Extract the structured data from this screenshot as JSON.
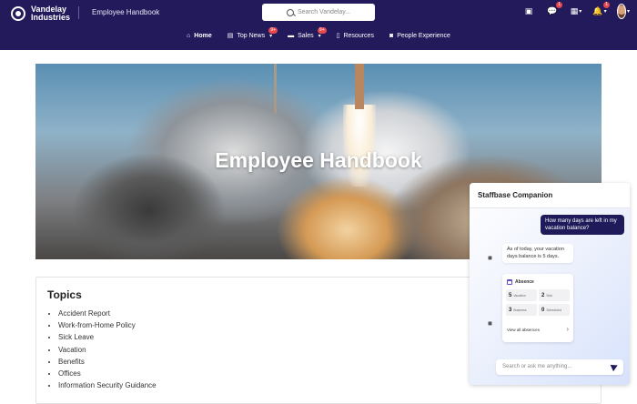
{
  "brand": {
    "name": "Vandelay Industries",
    "logo_icon": "vandelay-logo-icon"
  },
  "site_title": "Employee Handbook",
  "search": {
    "placeholder": "Search Vandelay..."
  },
  "header_icons": {
    "contacts": {
      "icon": "contact-card-icon"
    },
    "chat": {
      "icon": "chat-icon",
      "badge": "1"
    },
    "apps": {
      "icon": "grid-icon"
    },
    "notifications": {
      "icon": "bell-icon",
      "badge": "1"
    },
    "profile": {
      "icon": "avatar"
    }
  },
  "nav": [
    {
      "label": "Home",
      "icon": "home-icon",
      "active": true
    },
    {
      "label": "Top News",
      "icon": "news-icon",
      "badge": "9+",
      "has_dropdown": true
    },
    {
      "label": "Sales",
      "icon": "folder-icon",
      "badge": "9+",
      "has_dropdown": true
    },
    {
      "label": "Resources",
      "icon": "document-icon"
    },
    {
      "label": "People Experience",
      "icon": "camera-icon"
    }
  ],
  "hero": {
    "title": "Employee Handbook"
  },
  "topics": {
    "title": "Topics",
    "items": [
      "Accident Report",
      "Work-from-Home Policy",
      "Sick Leave",
      "Vacation",
      "Benefits",
      "Offices",
      "Information Security Guidance"
    ]
  },
  "companion": {
    "title": "Staffbase Companion",
    "user_message": "How many days are left in my vacation balance?",
    "bot_message": "As of today, your vacation days balance is 5 days.",
    "absence_card": {
      "title": "Absence",
      "stats": [
        {
          "value": "5",
          "label": "Vacation"
        },
        {
          "value": "2",
          "label": "Sick"
        },
        {
          "value": "3",
          "label": "Business"
        },
        {
          "value": "0",
          "label": "Scheduled"
        }
      ],
      "link": "View all absences"
    },
    "input_placeholder": "Search or ask me anything..."
  },
  "colors": {
    "header_bg": "#231a5c",
    "badge": "#e5484d",
    "accent": "#1f1b5a"
  }
}
